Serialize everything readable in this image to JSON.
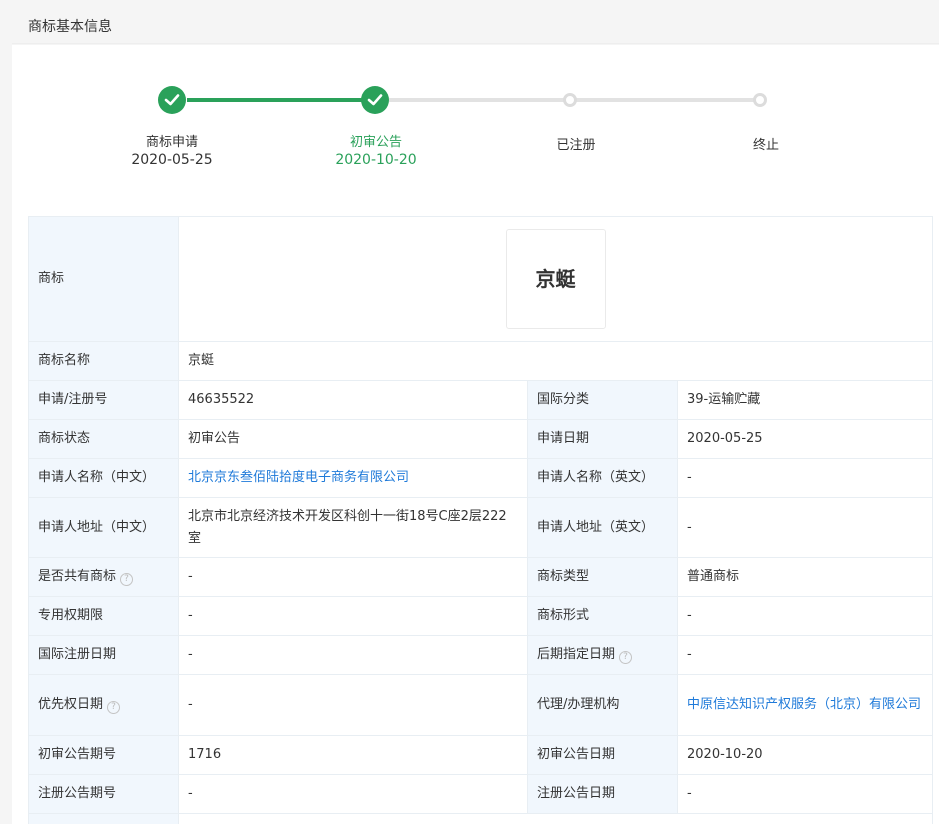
{
  "header": {
    "title": "商标基本信息"
  },
  "progress": {
    "steps": [
      {
        "label": "商标申请",
        "date": "2020-05-25",
        "status": "done"
      },
      {
        "label": "初审公告",
        "date": "2020-10-20",
        "status": "current"
      },
      {
        "label": "已注册",
        "date": "",
        "status": "todo"
      },
      {
        "label": "终止",
        "date": "",
        "status": "todo"
      }
    ],
    "colors": {
      "done": "#2aa15a",
      "todo": "#dcdcdc"
    }
  },
  "table": {
    "trademark": {
      "label": "商标",
      "image_text": "京蜓"
    },
    "name": {
      "label": "商标名称",
      "value": "京蜓"
    },
    "rows": [
      {
        "l1": "申请/注册号",
        "v1": "46635522",
        "l2": "国际分类",
        "v2": "39-运输贮藏"
      },
      {
        "l1": "商标状态",
        "v1": "初审公告",
        "l2": "申请日期",
        "v2": "2020-05-25"
      },
      {
        "l1": "申请人名称（中文）",
        "v1": "北京京东叁佰陆拾度电子商务有限公司",
        "l2": "申请人名称（英文）",
        "v2": "-"
      },
      {
        "l1": "申请人地址（中文）",
        "v1": "北京市北京经济技术开发区科创十一街18号C座2层222室",
        "l2": "申请人地址（英文）",
        "v2": "-"
      },
      {
        "l1": "是否共有商标",
        "v1": "-",
        "l2": "商标类型",
        "v2": "普通商标"
      },
      {
        "l1": "专用权期限",
        "v1": "-",
        "l2": "商标形式",
        "v2": "-"
      },
      {
        "l1": "国际注册日期",
        "v1": "-",
        "l2": "后期指定日期",
        "v2": "-"
      },
      {
        "l1": "优先权日期",
        "v1": "-",
        "l2": "代理/办理机构",
        "v2": "中原信达知识产权服务（北京）有限公司"
      },
      {
        "l1": "初审公告期号",
        "v1": "1716",
        "l2": "初审公告日期",
        "v2": "2020-10-20"
      },
      {
        "l1": "注册公告期号",
        "v1": "-",
        "l2": "注册公告日期",
        "v2": "-"
      }
    ],
    "help_glyph": "?",
    "link_color": "#1f7ad9",
    "label_bg": "#f1f7fd"
  }
}
